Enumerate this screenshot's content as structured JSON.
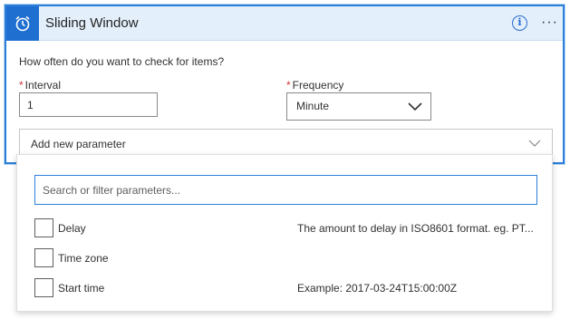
{
  "card": {
    "title": "Sliding Window",
    "header_icon": "alarm-clock-icon",
    "info_icon": "info-icon",
    "more_icon": "more-icon",
    "more_label": "···",
    "info_label": "i",
    "question": "How often do you want to check for items?",
    "interval": {
      "label": "Interval",
      "required_mark": "*",
      "value": "1"
    },
    "frequency": {
      "label": "Frequency",
      "required_mark": "*",
      "selected": "Minute"
    },
    "add_parameter": {
      "label": "Add new parameter"
    }
  },
  "dropdown": {
    "search_placeholder": "Search or filter parameters...",
    "params": [
      {
        "name": "Delay",
        "description": "The amount to delay in ISO8601 format. eg. PT...",
        "checked": false
      },
      {
        "name": "Time zone",
        "description": "",
        "checked": false
      },
      {
        "name": "Start time",
        "description": "Example: 2017-03-24T15:00:00Z",
        "checked": false
      }
    ]
  },
  "colors": {
    "accent": "#1f6fd0",
    "header_bg": "#e3effb",
    "required": "#d13438",
    "focus_border": "#2c7fd8"
  }
}
